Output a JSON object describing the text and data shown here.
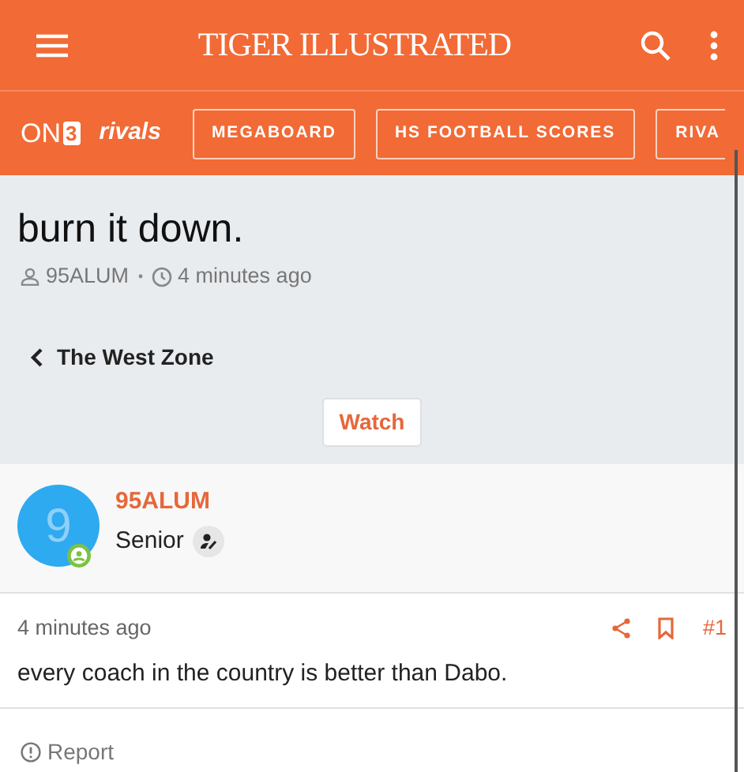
{
  "header": {
    "title": "TIGER ILLUSTRATED"
  },
  "nav": {
    "logos": [
      {
        "kind": "on3",
        "text": "ON",
        "mark": "3"
      },
      {
        "kind": "rivals",
        "text": "rivals"
      }
    ],
    "links": [
      {
        "label": "MEGABOARD",
        "cut": false
      },
      {
        "label": "HS FOOTBALL SCORES",
        "cut": false
      },
      {
        "label": "RIVA",
        "cut": true
      }
    ]
  },
  "thread": {
    "title": "burn it down.",
    "author": "95ALUM",
    "time": "4 minutes ago",
    "forum": "The West Zone",
    "watch_button": "Watch"
  },
  "post": {
    "avatar_letter": "9",
    "username": "95ALUM",
    "rank": "Senior",
    "time": "4 minutes ago",
    "number": "#1",
    "body": "every coach in the country is better than Dabo.",
    "report": "Report"
  }
}
